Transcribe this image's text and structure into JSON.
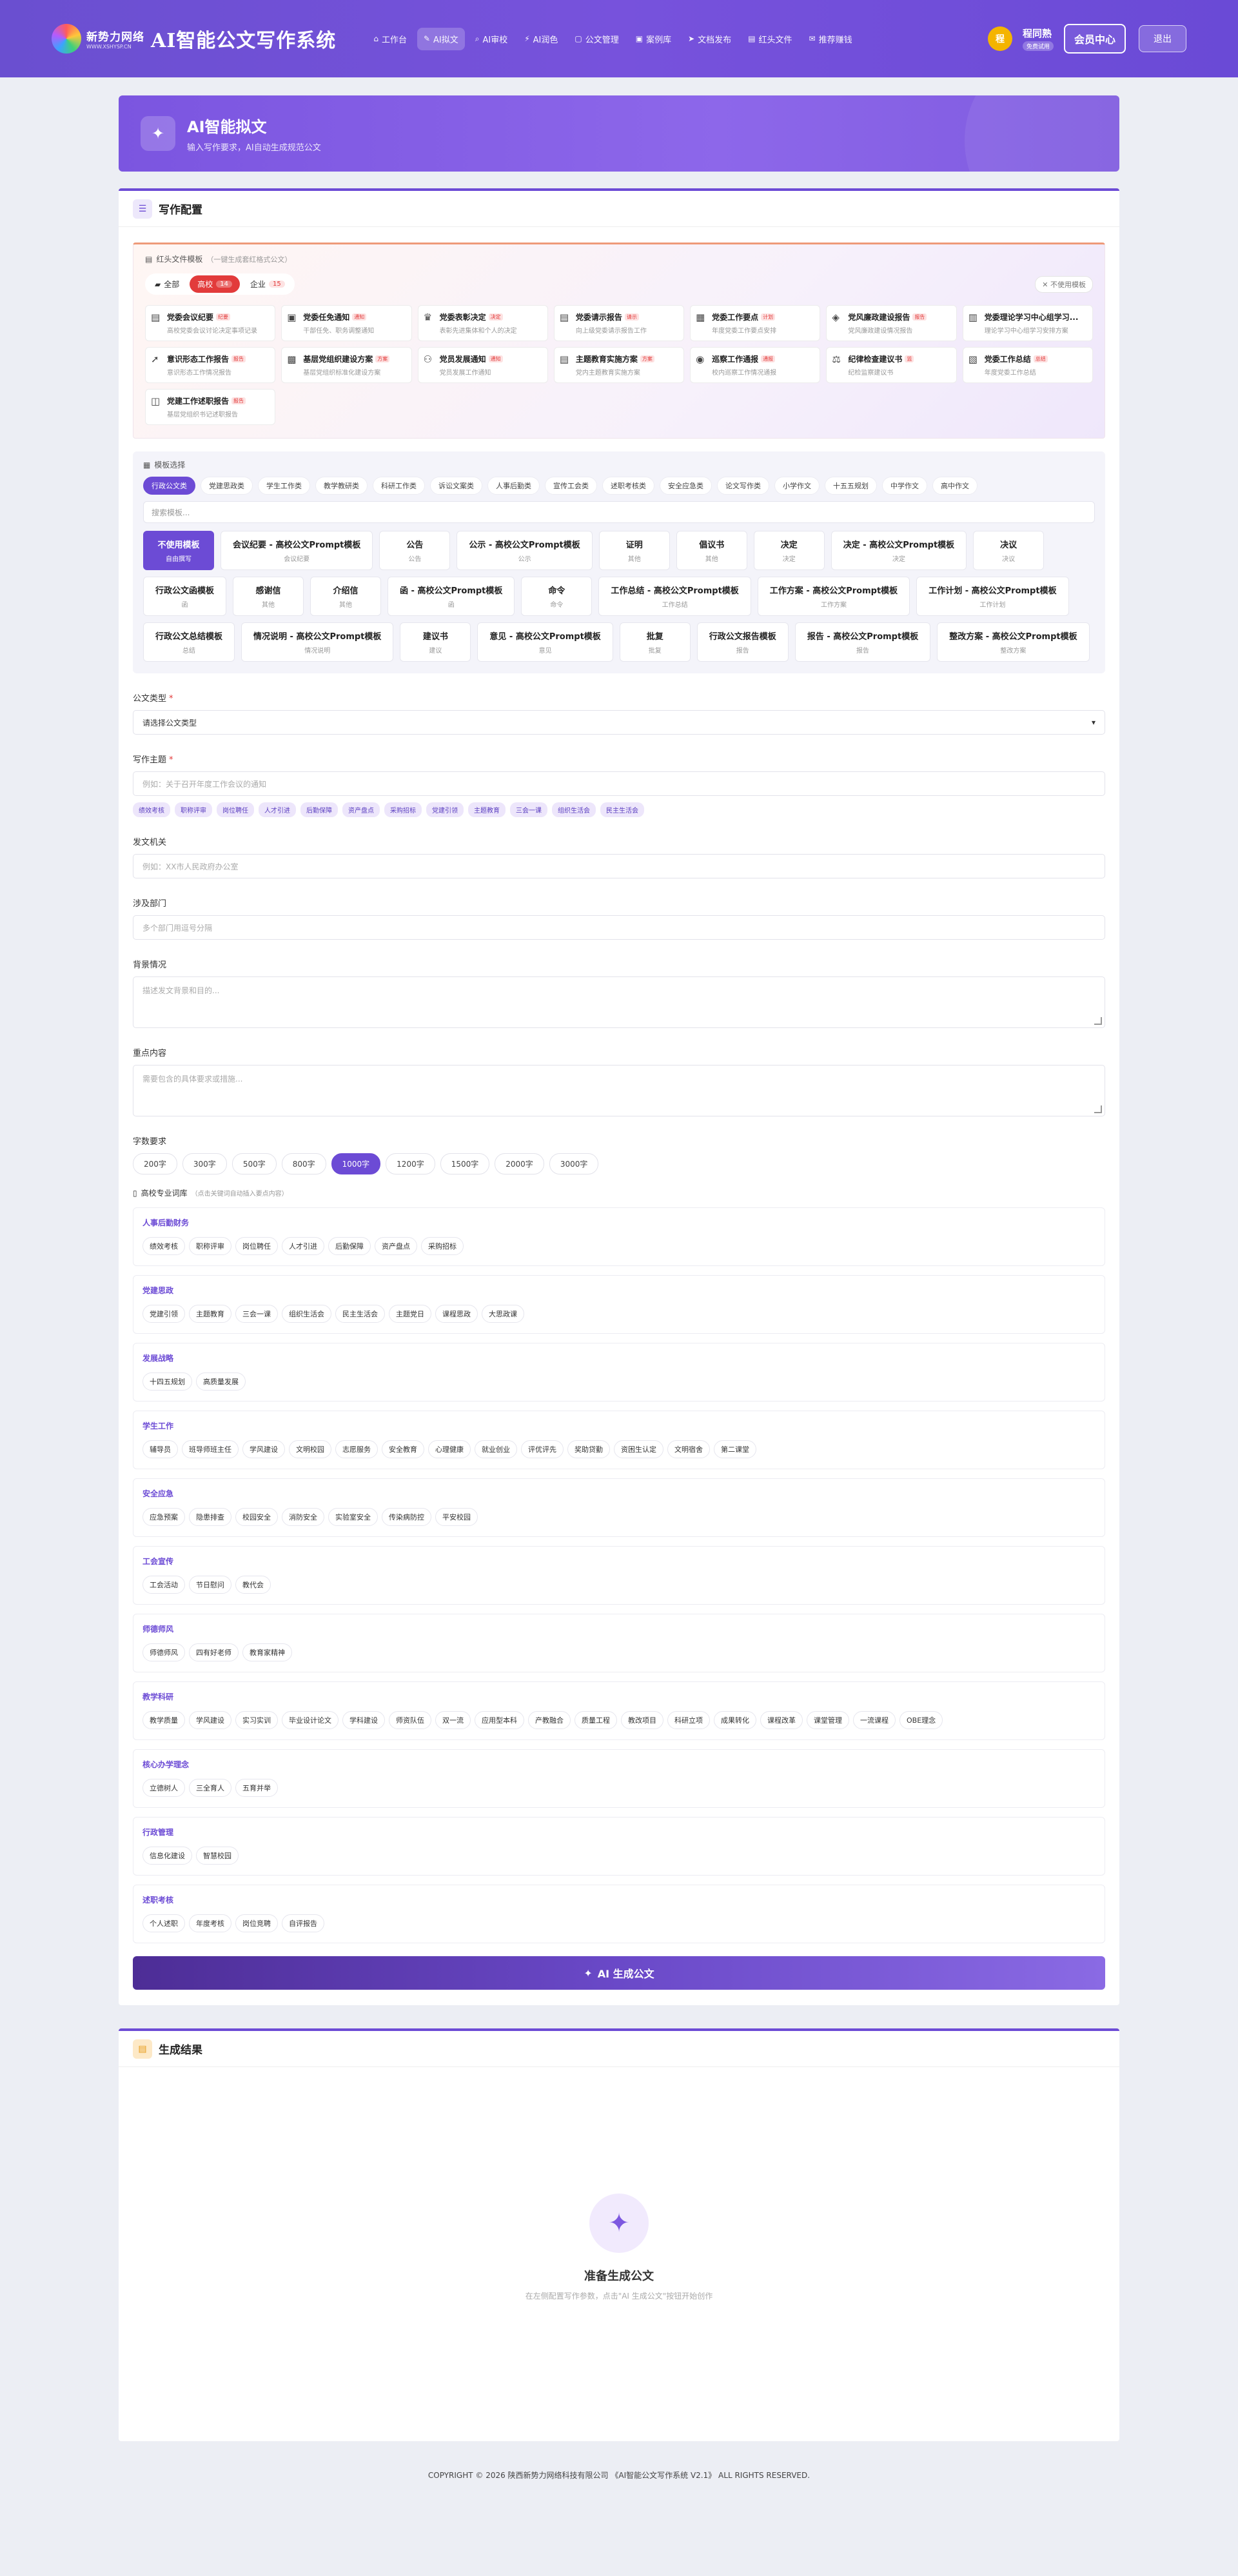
{
  "brand": {
    "logo_cn": "新势力网络",
    "logo_en": "WWW.XSHYSP.CN",
    "title": "AI智能公文写作系统"
  },
  "nav": [
    {
      "icon": "⌂",
      "label": "工作台",
      "active": false
    },
    {
      "icon": "✎",
      "label": "AI拟文",
      "active": true
    },
    {
      "icon": "⌕",
      "label": "AI审校",
      "active": false
    },
    {
      "icon": "⚡",
      "label": "AI润色",
      "active": false
    },
    {
      "icon": "▢",
      "label": "公文管理",
      "active": false
    },
    {
      "icon": "▣",
      "label": "案例库",
      "active": false
    },
    {
      "icon": "➤",
      "label": "文档发布",
      "active": false
    },
    {
      "icon": "▤",
      "label": "红头文件",
      "active": false
    },
    {
      "icon": "✉",
      "label": "推荐赚钱",
      "active": false
    }
  ],
  "user": {
    "avatar": "程",
    "name": "程同熟",
    "tag": "免费试用",
    "member_btn": "会员中心",
    "logout_btn": "退出"
  },
  "hero": {
    "icon": "✦",
    "title": "AI智能拟文",
    "subtitle": "输入写作要求，AI自动生成规范公文"
  },
  "config": {
    "icon": "☰",
    "title": "写作配置"
  },
  "redhead": {
    "label": "红头文件模板",
    "sub": "（一键生成套红格式公文）",
    "cats": [
      {
        "label": "全部",
        "count": "",
        "active": false
      },
      {
        "label": "高校",
        "count": "14",
        "active": true
      },
      {
        "label": "企业",
        "count": "15",
        "active": false
      }
    ],
    "no_use": "✕ 不使用模板",
    "templates": [
      {
        "icon": "▤",
        "title": "党委会议纪要",
        "tag": "纪要",
        "desc": "高校党委会议讨论决定事项记录"
      },
      {
        "icon": "▣",
        "title": "党委任免通知",
        "tag": "通知",
        "desc": "干部任免、职务调整通知"
      },
      {
        "icon": "♛",
        "title": "党委表彰决定",
        "tag": "决定",
        "desc": "表彰先进集体和个人的决定"
      },
      {
        "icon": "▤",
        "title": "党委请示报告",
        "tag": "请示",
        "desc": "向上级党委请示报告工作"
      },
      {
        "icon": "▦",
        "title": "党委工作要点",
        "tag": "计划",
        "desc": "年度党委工作要点安排"
      },
      {
        "icon": "◈",
        "title": "党风廉政建设报告",
        "tag": "报告",
        "desc": "党风廉政建设情况报告"
      },
      {
        "icon": "▥",
        "title": "党委理论学习中心组学习...",
        "tag": "",
        "desc": "理论学习中心组学习安排方案"
      },
      {
        "icon": "➚",
        "title": "意识形态工作报告",
        "tag": "报告",
        "desc": "意识形态工作情况报告"
      },
      {
        "icon": "▩",
        "title": "基层党组织建设方案",
        "tag": "方案",
        "desc": "基层党组织标准化建设方案"
      },
      {
        "icon": "⚇",
        "title": "党员发展通知",
        "tag": "通知",
        "desc": "党员发展工作通知"
      },
      {
        "icon": "▤",
        "title": "主题教育实施方案",
        "tag": "方案",
        "desc": "党内主题教育实施方案"
      },
      {
        "icon": "◉",
        "title": "巡察工作通报",
        "tag": "通报",
        "desc": "校内巡察工作情况通报"
      },
      {
        "icon": "⚖",
        "title": "纪律检查建议书",
        "tag": "监",
        "desc": "纪检监察建议书"
      },
      {
        "icon": "▧",
        "title": "党委工作总结",
        "tag": "总结",
        "desc": "年度党委工作总结"
      },
      {
        "icon": "◫",
        "title": "党建工作述职报告",
        "tag": "报告",
        "desc": "基层党组织书记述职报告"
      }
    ]
  },
  "tpl_select": {
    "label": "模板选择",
    "types": [
      "行政公文类",
      "党建思政类",
      "学生工作类",
      "教学教研类",
      "科研工作类",
      "诉讼文案类",
      "人事后勤类",
      "宣传工会类",
      "述职考核类",
      "安全应急类",
      "论文写作类",
      "小学作文",
      "十五五规划",
      "中学作文",
      "高中作文"
    ],
    "active_type": 0,
    "search_placeholder": "搜索模板...",
    "templates": [
      {
        "t": "不使用模板",
        "s": "自由撰写",
        "active": true
      },
      {
        "t": "会议纪要 - 高校公文Prompt模板",
        "s": "会议纪要"
      },
      {
        "t": "公告",
        "s": "公告"
      },
      {
        "t": "公示 - 高校公文Prompt模板",
        "s": "公示"
      },
      {
        "t": "证明",
        "s": "其他"
      },
      {
        "t": "倡议书",
        "s": "其他"
      },
      {
        "t": "决定",
        "s": "决定"
      },
      {
        "t": "决定 - 高校公文Prompt模板",
        "s": "决定"
      },
      {
        "t": "决议",
        "s": "决议"
      },
      {
        "t": "行政公文函模板",
        "s": "函"
      },
      {
        "t": "感谢信",
        "s": "其他"
      },
      {
        "t": "介绍信",
        "s": "其他"
      },
      {
        "t": "函 - 高校公文Prompt模板",
        "s": "函"
      },
      {
        "t": "命令",
        "s": "命令"
      },
      {
        "t": "工作总结 - 高校公文Prompt模板",
        "s": "工作总结"
      },
      {
        "t": "工作方案 - 高校公文Prompt模板",
        "s": "工作方案"
      },
      {
        "t": "工作计划 - 高校公文Prompt模板",
        "s": "工作计划"
      },
      {
        "t": "行政公文总结模板",
        "s": "总结"
      },
      {
        "t": "情况说明 - 高校公文Prompt模板",
        "s": "情况说明"
      },
      {
        "t": "建议书",
        "s": "建议"
      },
      {
        "t": "意见 - 高校公文Prompt模板",
        "s": "意见"
      },
      {
        "t": "批复",
        "s": "批复"
      },
      {
        "t": "行政公文报告模板",
        "s": "报告"
      },
      {
        "t": "报告 - 高校公文Prompt模板",
        "s": "报告"
      },
      {
        "t": "整改方案 - 高校公文Prompt模板",
        "s": "整改方案"
      }
    ]
  },
  "form": {
    "doc_type_label": "公文类型",
    "doc_type_value": "请选择公文类型",
    "topic_label": "写作主题",
    "topic_placeholder": "例如：关于召开年度工作会议的通知",
    "topic_chips": [
      "绩效考核",
      "职称评审",
      "岗位聘任",
      "人才引进",
      "后勤保障",
      "资产盘点",
      "采购招标",
      "党建引领",
      "主题教育",
      "三会一课",
      "组织生活会",
      "民主生活会"
    ],
    "issuer_label": "发文机关",
    "issuer_placeholder": "例如：XX市人民政府办公室",
    "dept_label": "涉及部门",
    "dept_placeholder": "多个部门用逗号分隔",
    "bg_label": "背景情况",
    "bg_placeholder": "描述发文背景和目的...",
    "key_label": "重点内容",
    "key_placeholder": "需要包含的具体要求或措施...",
    "wc_label": "字数要求",
    "wc_options": [
      "200字",
      "300字",
      "500字",
      "800字",
      "1000字",
      "1200字",
      "1500字",
      "2000字",
      "3000字"
    ],
    "wc_active": 4,
    "vocab_label": "高校专业词库",
    "vocab_note": "（点击关键词自动插入要点内容）",
    "vocab": [
      {
        "title": "人事后勤财务",
        "items": [
          "绩效考核",
          "职称评审",
          "岗位聘任",
          "人才引进",
          "后勤保障",
          "资产盘点",
          "采购招标"
        ]
      },
      {
        "title": "党建思政",
        "items": [
          "党建引领",
          "主题教育",
          "三会一课",
          "组织生活会",
          "民主生活会",
          "主题党日",
          "课程思政",
          "大思政课"
        ]
      },
      {
        "title": "发展战略",
        "items": [
          "十四五规划",
          "高质量发展"
        ]
      },
      {
        "title": "学生工作",
        "items": [
          "辅导员",
          "班导师班主任",
          "学风建设",
          "文明校园",
          "志愿服务",
          "安全教育",
          "心理健康",
          "就业创业",
          "评优评先",
          "奖助贷勤",
          "资困生认定",
          "文明宿舍",
          "第二课堂"
        ]
      },
      {
        "title": "安全应急",
        "items": [
          "应急预案",
          "隐患排查",
          "校园安全",
          "消防安全",
          "实验室安全",
          "传染病防控",
          "平安校园"
        ]
      },
      {
        "title": "工会宣传",
        "items": [
          "工会活动",
          "节日慰问",
          "教代会"
        ]
      },
      {
        "title": "师德师风",
        "items": [
          "师德师风",
          "四有好老师",
          "教育家精神"
        ]
      },
      {
        "title": "教学科研",
        "items": [
          "教学质量",
          "学风建设",
          "实习实训",
          "毕业设计论文",
          "学科建设",
          "师资队伍",
          "双一流",
          "应用型本科",
          "产教融合",
          "质量工程",
          "教改项目",
          "科研立项",
          "成果转化",
          "课程改革",
          "课堂管理",
          "一流课程",
          "OBE理念"
        ]
      },
      {
        "title": "核心办学理念",
        "items": [
          "立德树人",
          "三全育人",
          "五育并举"
        ]
      },
      {
        "title": "行政管理",
        "items": [
          "信息化建设",
          "智慧校园"
        ]
      },
      {
        "title": "述职考核",
        "items": [
          "个人述职",
          "年度考核",
          "岗位竞聘",
          "自评报告"
        ]
      }
    ],
    "gen_btn": "AI 生成公文",
    "gen_icon": "✦"
  },
  "result": {
    "icon": "▤",
    "title": "生成结果",
    "empty_icon": "✦",
    "empty_title": "准备生成公文",
    "empty_desc": "在左侧配置写作参数，点击\"AI 生成公文\"按钮开始创作"
  },
  "footer": "COPYRIGHT © 2026 陕西新势力网络科技有限公司 《AI智能公文写作系统 V2.1》 ALL RIGHTS RESERVED."
}
